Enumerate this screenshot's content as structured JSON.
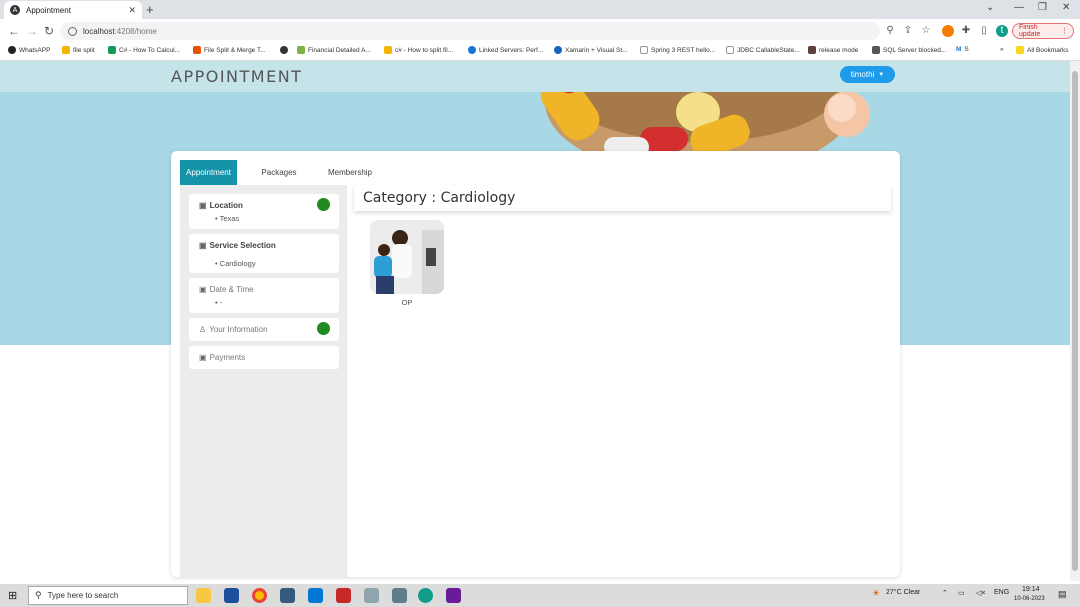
{
  "browser": {
    "tab_title": "Appointment",
    "url_host": "localhost",
    "url_path": ":4208/home",
    "finish_update": "Finish update",
    "all_bookmarks": "All Bookmarks",
    "bookmarks": [
      "WhatsAPP",
      "file split",
      "C# - How To Calcul...",
      "File Split & Merge T...",
      "Financial Detailed A...",
      "c# - How to split fil...",
      "Linked Servers: Perf...",
      "Xamarin + Visual St...",
      "Spring 3 REST hello...",
      "JDBC CallableState...",
      "release mode",
      "SQL Server blocked...",
      "S"
    ],
    "profile_initial": "t"
  },
  "header": {
    "brand": "APPOINTMENT",
    "user": "timothi"
  },
  "tabs": [
    "Appointment",
    "Packages",
    "Membership"
  ],
  "steps": [
    {
      "title": "Location",
      "value": "Texas",
      "done": true
    },
    {
      "title": "Service Selection",
      "value": "Cardiology",
      "done": false
    },
    {
      "title": "Date & Time",
      "value": "-",
      "done": false
    },
    {
      "title": "Your Information",
      "value": "",
      "done": true
    },
    {
      "title": "Payments",
      "value": "",
      "done": false
    }
  ],
  "category": {
    "title": "Category : Cardiology",
    "service_label": "OP"
  },
  "taskbar": {
    "search_placeholder": "Type here to search",
    "weather": "27°C  Clear",
    "lang": "ENG",
    "time": "19:14",
    "date": "10-06-2023"
  }
}
